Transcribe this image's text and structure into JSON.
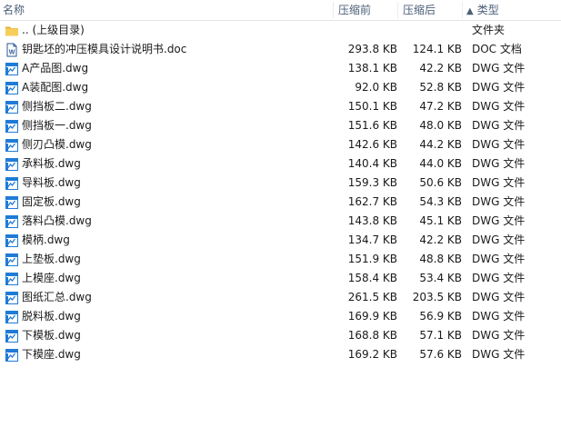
{
  "columns": {
    "name": "名称",
    "size": "压缩前",
    "packed": "压缩后",
    "type": "类型",
    "sort_indicator": "▲"
  },
  "icons": {
    "folder": "folder-icon",
    "doc": "word-document-icon",
    "dwg": "dwg-drawing-icon"
  },
  "colors": {
    "header_text": "#4c607a",
    "folder_yellow": "#f4c542",
    "dwg_blue": "#1f7bd6",
    "doc_blue": "#2b5797"
  },
  "rows": [
    {
      "name": ".. (上级目录)",
      "size": "",
      "packed": "",
      "type": "文件夹",
      "icon": "folder"
    },
    {
      "name": "钥匙坯的冲压模具设计说明书.doc",
      "size": "293.8 KB",
      "packed": "124.1 KB",
      "type": "DOC 文档",
      "icon": "doc"
    },
    {
      "name": "A产品图.dwg",
      "size": "138.1 KB",
      "packed": "42.2 KB",
      "type": "DWG 文件",
      "icon": "dwg"
    },
    {
      "name": "A装配图.dwg",
      "size": "92.0 KB",
      "packed": "52.8 KB",
      "type": "DWG 文件",
      "icon": "dwg"
    },
    {
      "name": "侧挡板二.dwg",
      "size": "150.1 KB",
      "packed": "47.2 KB",
      "type": "DWG 文件",
      "icon": "dwg"
    },
    {
      "name": "侧挡板一.dwg",
      "size": "151.6 KB",
      "packed": "48.0 KB",
      "type": "DWG 文件",
      "icon": "dwg"
    },
    {
      "name": "侧刃凸模.dwg",
      "size": "142.6 KB",
      "packed": "44.2 KB",
      "type": "DWG 文件",
      "icon": "dwg"
    },
    {
      "name": "承料板.dwg",
      "size": "140.4 KB",
      "packed": "44.0 KB",
      "type": "DWG 文件",
      "icon": "dwg"
    },
    {
      "name": "导料板.dwg",
      "size": "159.3 KB",
      "packed": "50.6 KB",
      "type": "DWG 文件",
      "icon": "dwg"
    },
    {
      "name": "固定板.dwg",
      "size": "162.7 KB",
      "packed": "54.3 KB",
      "type": "DWG 文件",
      "icon": "dwg"
    },
    {
      "name": "落料凸模.dwg",
      "size": "143.8 KB",
      "packed": "45.1 KB",
      "type": "DWG 文件",
      "icon": "dwg"
    },
    {
      "name": "模柄.dwg",
      "size": "134.7 KB",
      "packed": "42.2 KB",
      "type": "DWG 文件",
      "icon": "dwg"
    },
    {
      "name": "上垫板.dwg",
      "size": "151.9 KB",
      "packed": "48.8 KB",
      "type": "DWG 文件",
      "icon": "dwg"
    },
    {
      "name": "上模座.dwg",
      "size": "158.4 KB",
      "packed": "53.4 KB",
      "type": "DWG 文件",
      "icon": "dwg"
    },
    {
      "name": "图纸汇总.dwg",
      "size": "261.5 KB",
      "packed": "203.5 KB",
      "type": "DWG 文件",
      "icon": "dwg"
    },
    {
      "name": "脱料板.dwg",
      "size": "169.9 KB",
      "packed": "56.9 KB",
      "type": "DWG 文件",
      "icon": "dwg"
    },
    {
      "name": "下模板.dwg",
      "size": "168.8 KB",
      "packed": "57.1 KB",
      "type": "DWG 文件",
      "icon": "dwg"
    },
    {
      "name": "下模座.dwg",
      "size": "169.2 KB",
      "packed": "57.6 KB",
      "type": "DWG 文件",
      "icon": "dwg"
    }
  ]
}
